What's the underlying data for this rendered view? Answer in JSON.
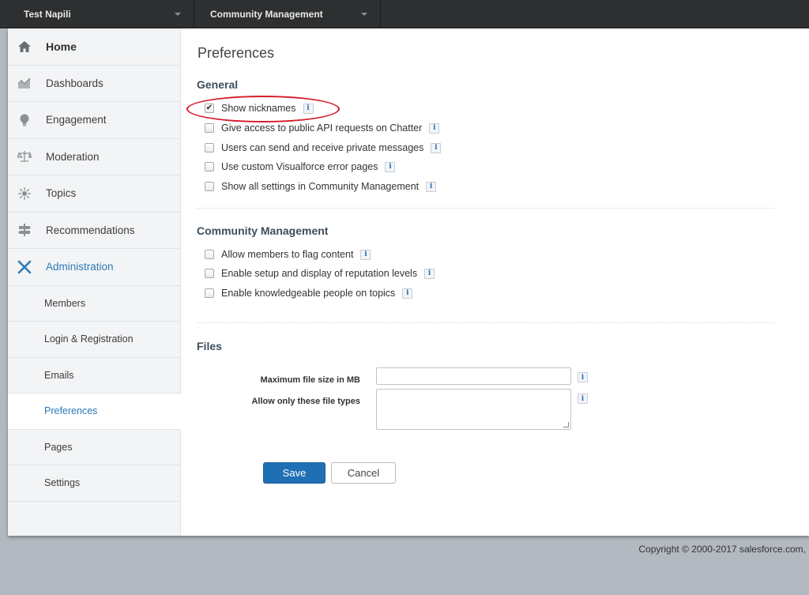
{
  "topbar": {
    "community": "Test Napili",
    "workspace": "Community Management"
  },
  "sidebar": {
    "items": [
      {
        "label": "Home",
        "icon": "home-icon"
      },
      {
        "label": "Dashboards",
        "icon": "chart-icon"
      },
      {
        "label": "Engagement",
        "icon": "lightbulb-icon"
      },
      {
        "label": "Moderation",
        "icon": "scales-icon"
      },
      {
        "label": "Topics",
        "icon": "topics-icon"
      },
      {
        "label": "Recommendations",
        "icon": "signpost-icon"
      },
      {
        "label": "Administration",
        "icon": "tools-icon"
      }
    ],
    "sub_items": [
      {
        "label": "Members"
      },
      {
        "label": "Login & Registration"
      },
      {
        "label": "Emails"
      },
      {
        "label": "Preferences"
      },
      {
        "label": "Pages"
      },
      {
        "label": "Settings"
      }
    ]
  },
  "main": {
    "title": "Preferences",
    "general": {
      "title": "General",
      "options": [
        {
          "label": "Show nicknames",
          "checked": true
        },
        {
          "label": "Give access to public API requests on Chatter",
          "checked": false
        },
        {
          "label": "Users can send and receive private messages",
          "checked": false
        },
        {
          "label": "Use custom Visualforce error pages",
          "checked": false
        },
        {
          "label": "Show all settings in Community Management",
          "checked": false
        }
      ]
    },
    "community_management": {
      "title": "Community Management",
      "options": [
        {
          "label": "Allow members to flag content",
          "checked": false
        },
        {
          "label": "Enable setup and display of reputation levels",
          "checked": false
        },
        {
          "label": "Enable knowledgeable people on topics",
          "checked": false
        }
      ]
    },
    "files": {
      "title": "Files",
      "max_size_label": "Maximum file size in MB",
      "max_size_value": "",
      "file_types_label": "Allow only these file types",
      "file_types_value": ""
    },
    "save_label": "Save",
    "cancel_label": "Cancel",
    "info_glyph": "i",
    "check_glyph": "✔"
  },
  "footer": {
    "copyright": "Copyright © 2000-2017 salesforce.com,"
  },
  "colors": {
    "accent": "#2d7ab8",
    "save_button": "#1f6fb4",
    "highlight": "#d61c2a"
  }
}
